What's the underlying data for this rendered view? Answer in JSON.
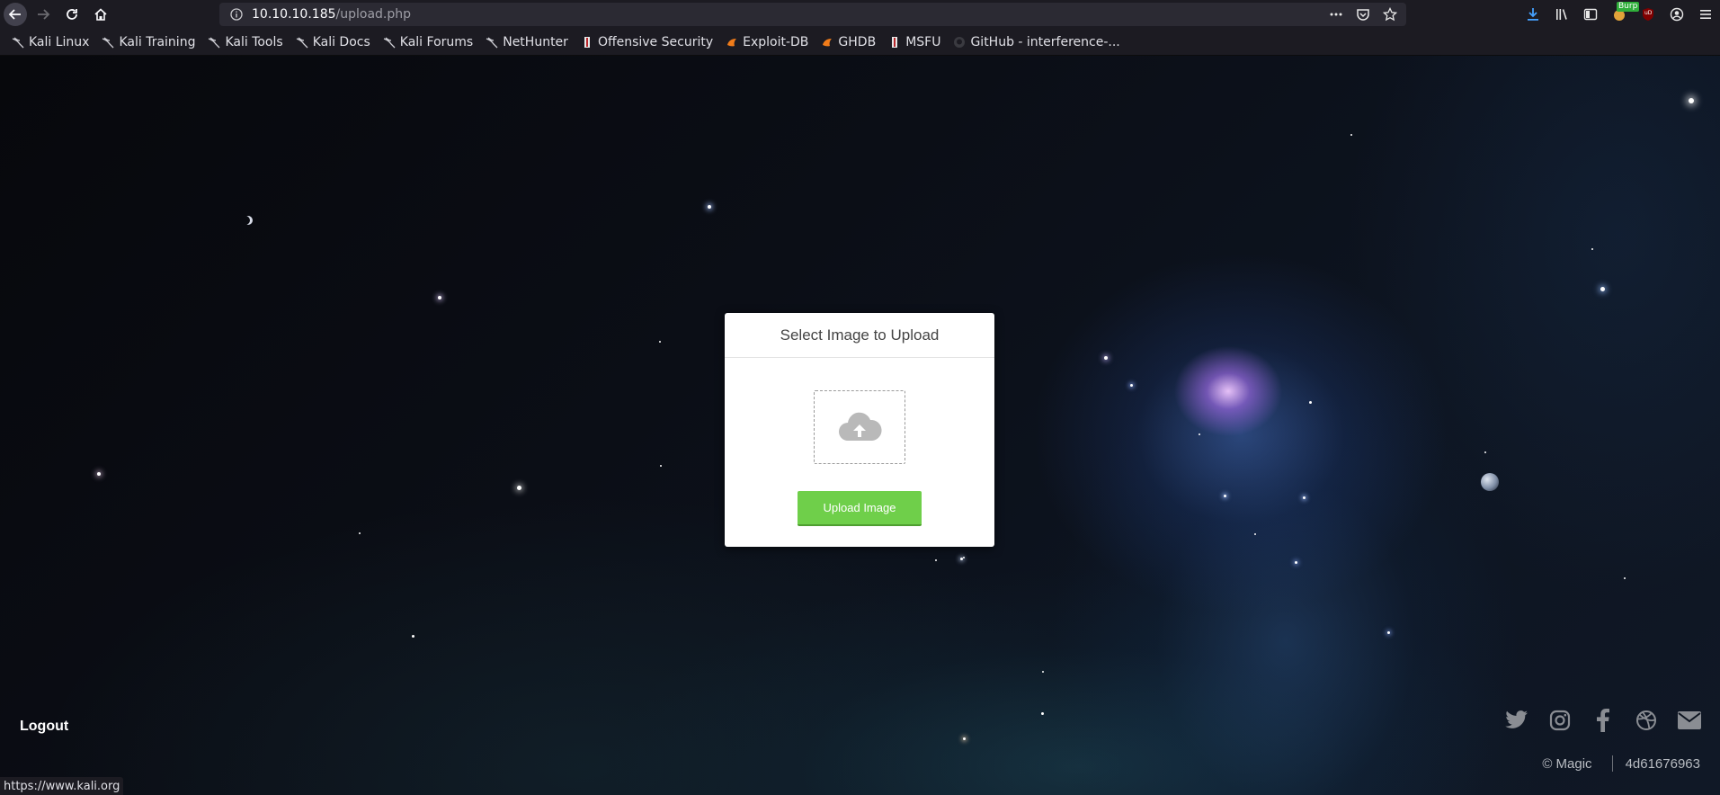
{
  "browser": {
    "url_host": "10.10.10.185",
    "url_path": "/upload.php",
    "burp_badge": "Burp",
    "ublock_badge": "uD",
    "icons": {
      "back": "arrow-left-icon",
      "forward": "arrow-right-icon",
      "reload": "reload-icon",
      "home": "home-icon",
      "info": "info-icon",
      "more": "ellipsis-icon",
      "pocket": "pocket-icon",
      "bookmark": "star-icon",
      "download": "download-icon",
      "library": "library-icon",
      "sidebar": "sidebar-icon",
      "account": "account-icon",
      "menu": "hamburger-menu-icon"
    }
  },
  "bookmarks": [
    {
      "label": "Kali Linux",
      "icon": "kali-dragon-icon"
    },
    {
      "label": "Kali Training",
      "icon": "kali-dragon-icon"
    },
    {
      "label": "Kali Tools",
      "icon": "kali-dragon-icon"
    },
    {
      "label": "Kali Docs",
      "icon": "kali-dragon-icon"
    },
    {
      "label": "Kali Forums",
      "icon": "kali-dragon-icon"
    },
    {
      "label": "NetHunter",
      "icon": "kali-dragon-icon"
    },
    {
      "label": "Offensive Security",
      "icon": "offsec-icon"
    },
    {
      "label": "Exploit-DB",
      "icon": "exploitdb-icon"
    },
    {
      "label": "GHDB",
      "icon": "exploitdb-icon"
    },
    {
      "label": "MSFU",
      "icon": "offsec-icon"
    },
    {
      "label": "GitHub - interference-...",
      "icon": "github-icon"
    }
  ],
  "upload_card": {
    "title": "Select Image to Upload",
    "dropzone_icon": "cloud-upload-icon",
    "button_label": "Upload Image",
    "button_color": "#6fcf4a"
  },
  "footer": {
    "logout_label": "Logout",
    "social_icons": [
      "twitter-icon",
      "instagram-icon",
      "facebook-icon",
      "dribbble-icon",
      "mail-icon"
    ],
    "copyright": "© Magic",
    "hash": "4d61676963"
  },
  "statusbar": {
    "text": "https://www.kali.org"
  }
}
